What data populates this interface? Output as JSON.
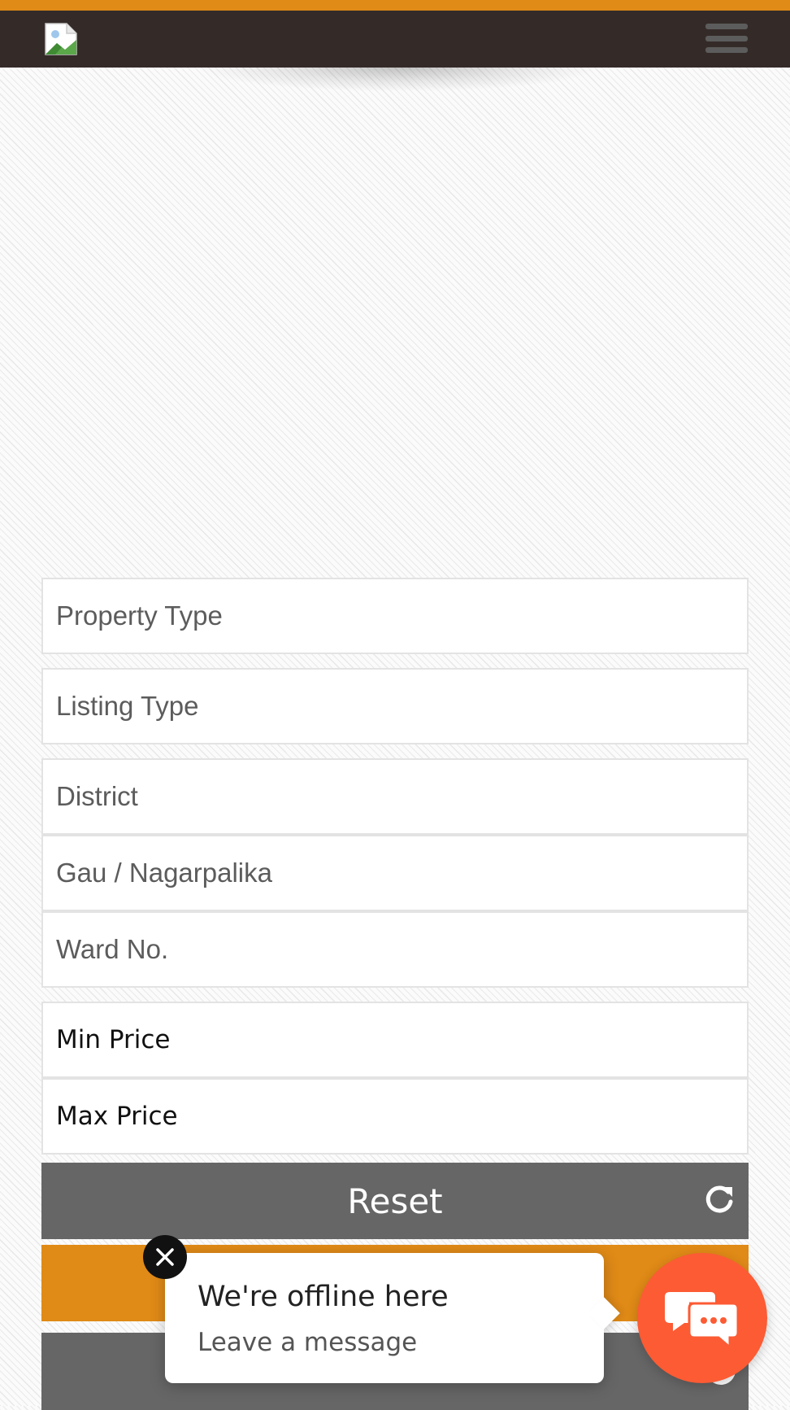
{
  "colors": {
    "accent": "#e08a17",
    "navbar": "#342b29",
    "button_gray": "#666666",
    "chat_launcher": "#fc5b34"
  },
  "navbar": {
    "logo_icon": "broken-image-icon",
    "menu_icon": "hamburger-menu-icon"
  },
  "search_form": {
    "property_type_placeholder": "Property Type",
    "listing_type_placeholder": "Listing Type",
    "district_placeholder": "District",
    "gau_nagarpalika_placeholder": "Gau / Nagarpalika",
    "ward_no_placeholder": "Ward No.",
    "min_price_placeholder": "Min Price",
    "max_price_placeholder": "Max Price",
    "reset_label": "Reset",
    "reset_icon": "refresh-icon"
  },
  "chat_widget": {
    "title": "We're offline here",
    "subtitle": "Leave a message",
    "close_icon": "close-icon",
    "launcher_icon": "chat-bubbles-icon"
  }
}
